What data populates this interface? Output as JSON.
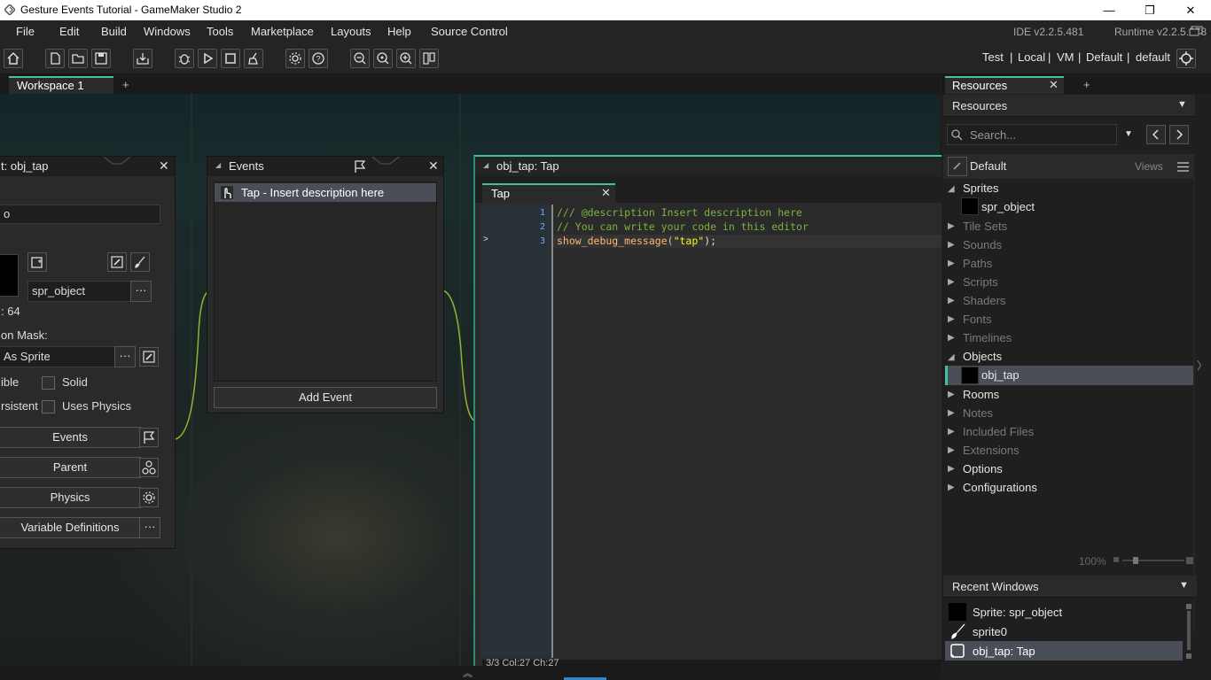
{
  "window": {
    "title": "Gesture Events Tutorial - GameMaker Studio 2",
    "minimize": "—",
    "maximize": "❐",
    "close": "✕"
  },
  "menu": {
    "items": [
      "File",
      "Edit",
      "Build",
      "Windows",
      "Tools",
      "Marketplace",
      "Layouts",
      "Help",
      "Source Control"
    ],
    "ide_version": "IDE v2.2.5.481",
    "runtime_version": "Runtime v2.2.5.378"
  },
  "toolbar": {
    "target": [
      "Test",
      "|",
      "Local",
      "|",
      "VM",
      "|",
      "Default",
      "|",
      "default"
    ]
  },
  "workspace": {
    "tab": "Workspace 1",
    "add": "+"
  },
  "object_panel": {
    "title": "t: obj_tap",
    "name_value": "o",
    "sprite_value": "spr_object",
    "sprite_size": ": 64",
    "mask_label": "on Mask:",
    "mask_value": "As Sprite",
    "visible_label": "ible",
    "solid_label": "Solid",
    "persistent_label": "rsistent",
    "physics_label": "Uses Physics",
    "events_button": "Events",
    "parent_button": "Parent",
    "physics_button": "Physics",
    "variables_button": "Variable Definitions",
    "ellipsis": "···"
  },
  "events_panel": {
    "title": "Events",
    "event_item": "Tap - Insert description here",
    "add_event": "Add Event"
  },
  "code_editor": {
    "window_title": "obj_tap: Tap",
    "tab": "Tap",
    "lines": [
      {
        "n": "1",
        "text": "/// @description Insert description here"
      },
      {
        "n": "2",
        "text": "// You can write your code in this editor"
      },
      {
        "n": "3",
        "text": "show_debug_message(\"tap\");"
      }
    ],
    "status": "3/3 Col:27 Ch:27"
  },
  "resources": {
    "tab": "Resources",
    "header": "Resources",
    "search_placeholder": "Search...",
    "group": "Default",
    "views": "Views",
    "tree": [
      {
        "label": "Sprites",
        "expanded": true,
        "active": true
      },
      {
        "label": "spr_object",
        "child": true
      },
      {
        "label": "Tile Sets",
        "active": false
      },
      {
        "label": "Sounds",
        "active": false
      },
      {
        "label": "Paths",
        "active": false
      },
      {
        "label": "Scripts",
        "active": false
      },
      {
        "label": "Shaders",
        "active": false
      },
      {
        "label": "Fonts",
        "active": false
      },
      {
        "label": "Timelines",
        "active": false
      },
      {
        "label": "Objects",
        "expanded": true,
        "active": true
      },
      {
        "label": "obj_tap",
        "child": true,
        "selected": true
      },
      {
        "label": "Rooms",
        "active": true
      },
      {
        "label": "Notes",
        "active": false
      },
      {
        "label": "Included Files",
        "active": false
      },
      {
        "label": "Extensions",
        "active": false
      },
      {
        "label": "Options",
        "active": true
      },
      {
        "label": "Configurations",
        "active": true
      }
    ],
    "zoom": "100%"
  },
  "recent_windows": {
    "header": "Recent Windows",
    "items": [
      "Sprite: spr_object",
      "sprite0",
      "obj_tap: Tap"
    ]
  },
  "colors": {
    "accent": "#44c0a0",
    "selection": "#4a4f57",
    "code_comment": "#7cb342",
    "code_function": "#ffb871",
    "code_string": "#fcf320"
  }
}
